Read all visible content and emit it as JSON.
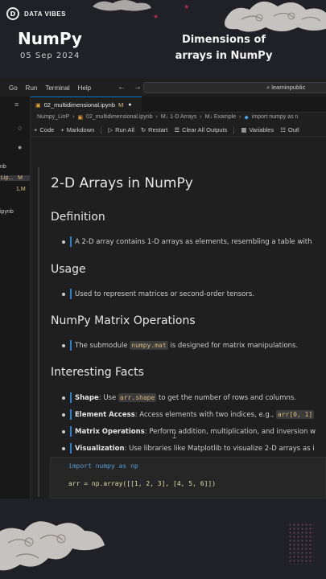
{
  "brand": {
    "logo_icon": "data-vibes-logo-icon",
    "name": "DATA VIBES"
  },
  "header": {
    "title": "NumPy",
    "date": "05 Sep 2024",
    "subtitle_line1": "Dimensions of",
    "subtitle_line2": "arrays in NumPy"
  },
  "menu": {
    "items": [
      "Go",
      "Run",
      "Terminal",
      "Help"
    ],
    "search": "learninpublic"
  },
  "sidebar": {
    "files": [
      {
        "label": "nb",
        "badge": ""
      },
      {
        "label": "Lip...",
        "badge": "M"
      },
      {
        "label": "",
        "badge": "1,M"
      },
      {
        "label": "ipynb",
        "badge": ""
      }
    ]
  },
  "tab": {
    "label": "02_multidimensional.ipynb",
    "modified_badge": "M"
  },
  "breadcrumb": [
    "Numpy_LinP",
    "02_multidimensional.ipynb",
    "M↓ 1-D Arrays",
    "M↓ Example",
    "import numpy as n"
  ],
  "toolbar": {
    "code": "Code",
    "markdown": "Markdown",
    "run_all": "Run All",
    "restart": "Restart",
    "clear": "Clear All Outputs",
    "variables": "Variables",
    "outline": "Outl"
  },
  "notebook": {
    "h1": "2-D Arrays in NumPy",
    "sections": [
      {
        "heading": "Definition",
        "text": "A 2-D array contains 1-D arrays as elements, resembling a table with"
      },
      {
        "heading": "Usage",
        "text": "Used to represent matrices or second-order tensors."
      },
      {
        "heading": "NumPy Matrix Operations",
        "text_before": "The submodule ",
        "code": "numpy.mat",
        "text_after": " is designed for matrix manipulations."
      },
      {
        "heading": "Interesting Facts"
      }
    ],
    "facts": [
      {
        "bold": "Shape",
        "text_before": ": Use ",
        "code": "arr.shape",
        "text_after": " to get the number of rows and columns."
      },
      {
        "bold": "Element Access",
        "text_before": ": Access elements with two indices, e.g., ",
        "code": "arr[0, 1]",
        "text_after": ""
      },
      {
        "bold": "Matrix Operations",
        "text_before": ": Perform addition, multiplication, and inversion w",
        "code": "",
        "text_after": ""
      },
      {
        "bold": "Visualization",
        "text_before": ": Use libraries like Matplotlib to visualize 2-D arrays as i",
        "code": "",
        "text_after": ""
      }
    ],
    "code_lines": [
      "import numpy as np",
      "arr = np.array([[1, 2, 3], [4, 5, 6]])"
    ]
  },
  "colors": {
    "accent_blue": "#2f7fd4",
    "star_red": "#b03050",
    "inline_code": "#d7ba7d"
  }
}
